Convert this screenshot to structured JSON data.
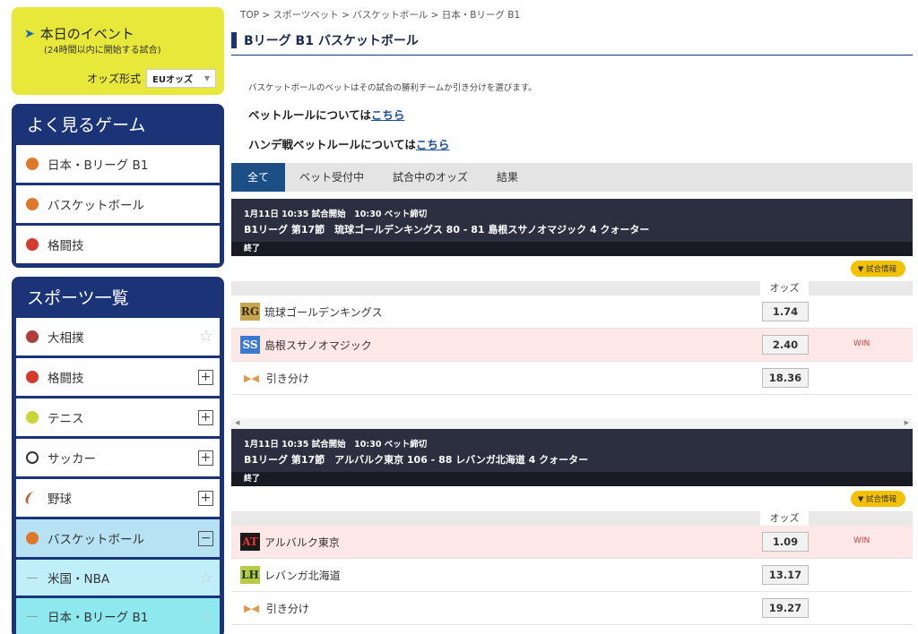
{
  "sidebar": {
    "event_title": "本日のイベント",
    "event_sub": "(24時間以内に開始する試合)",
    "odds_label": "オッズ形式",
    "odds_value": "EUオッズ",
    "favorites_title": "よく見るゲーム",
    "favorites": [
      {
        "label": "日本・Bリーグ B1",
        "icon": "basketball-icon"
      },
      {
        "label": "バスケットボール",
        "icon": "basketball-icon"
      },
      {
        "label": "格闘技",
        "icon": "boxing-glove-icon"
      }
    ],
    "sports_title": "スポーツ一覧",
    "sports": [
      {
        "label": "大相撲",
        "icon": "sumo-icon"
      },
      {
        "label": "格闘技",
        "icon": "boxing-glove-icon"
      },
      {
        "label": "テニス",
        "icon": "tennis-ball-icon"
      },
      {
        "label": "サッカー",
        "icon": "soccer-ball-icon"
      },
      {
        "label": "野球",
        "icon": "baseball-bat-icon"
      },
      {
        "label": "バスケットボール",
        "icon": "basketball-icon"
      }
    ],
    "sub_items": [
      "米国・NBA",
      "日本・Bリーグ B1"
    ]
  },
  "breadcrumb": "TOP > スポーツベット > バスケットボール > 日本・Bリーグ B1",
  "page_title": "Bリーグ B1 バスケットボール",
  "note": "バスケットボールのベットはその試合の勝利チームか引き分けを選びます。",
  "rule_text": "ベットルールについては",
  "rule_link": "こちら",
  "handicap_text": "ハンデ戦ベットルールについては",
  "handicap_link": "こちら",
  "tabs": [
    "全て",
    "ベット受付中",
    "試合中のオッズ",
    "結果"
  ],
  "info_label": "試合情報",
  "odds_header": "オッズ",
  "win_label": "WIN",
  "matches": [
    {
      "line1": "1月11日 10:35 試合開始　10:30 ベット締切",
      "line2": "B1リーグ 第17節　琉球ゴールデンキングス 80 - 81 島根スサノオマジック 4 クォーター",
      "status": "終了",
      "rows": [
        {
          "logo": "RG",
          "name": "琉球ゴールデンキングス",
          "odds": "1.74"
        },
        {
          "logo": "SS",
          "name": "島根スサノオマジック",
          "odds": "2.40"
        },
        {
          "logo": "",
          "name": "引き分け",
          "odds": "18.36"
        }
      ]
    },
    {
      "line1": "1月11日 10:35 試合開始　10:30 ベット締切",
      "line2": "B1リーグ 第17節　アルバルク東京 106 - 88 レバンガ北海道 4 クォーター",
      "status": "終了",
      "rows": [
        {
          "logo": "AT",
          "name": "アルバルク東京",
          "odds": "1.09"
        },
        {
          "logo": "LH",
          "name": "レバンガ北海道",
          "odds": "13.17"
        },
        {
          "logo": "",
          "name": "引き分け",
          "odds": "19.27"
        }
      ]
    }
  ]
}
